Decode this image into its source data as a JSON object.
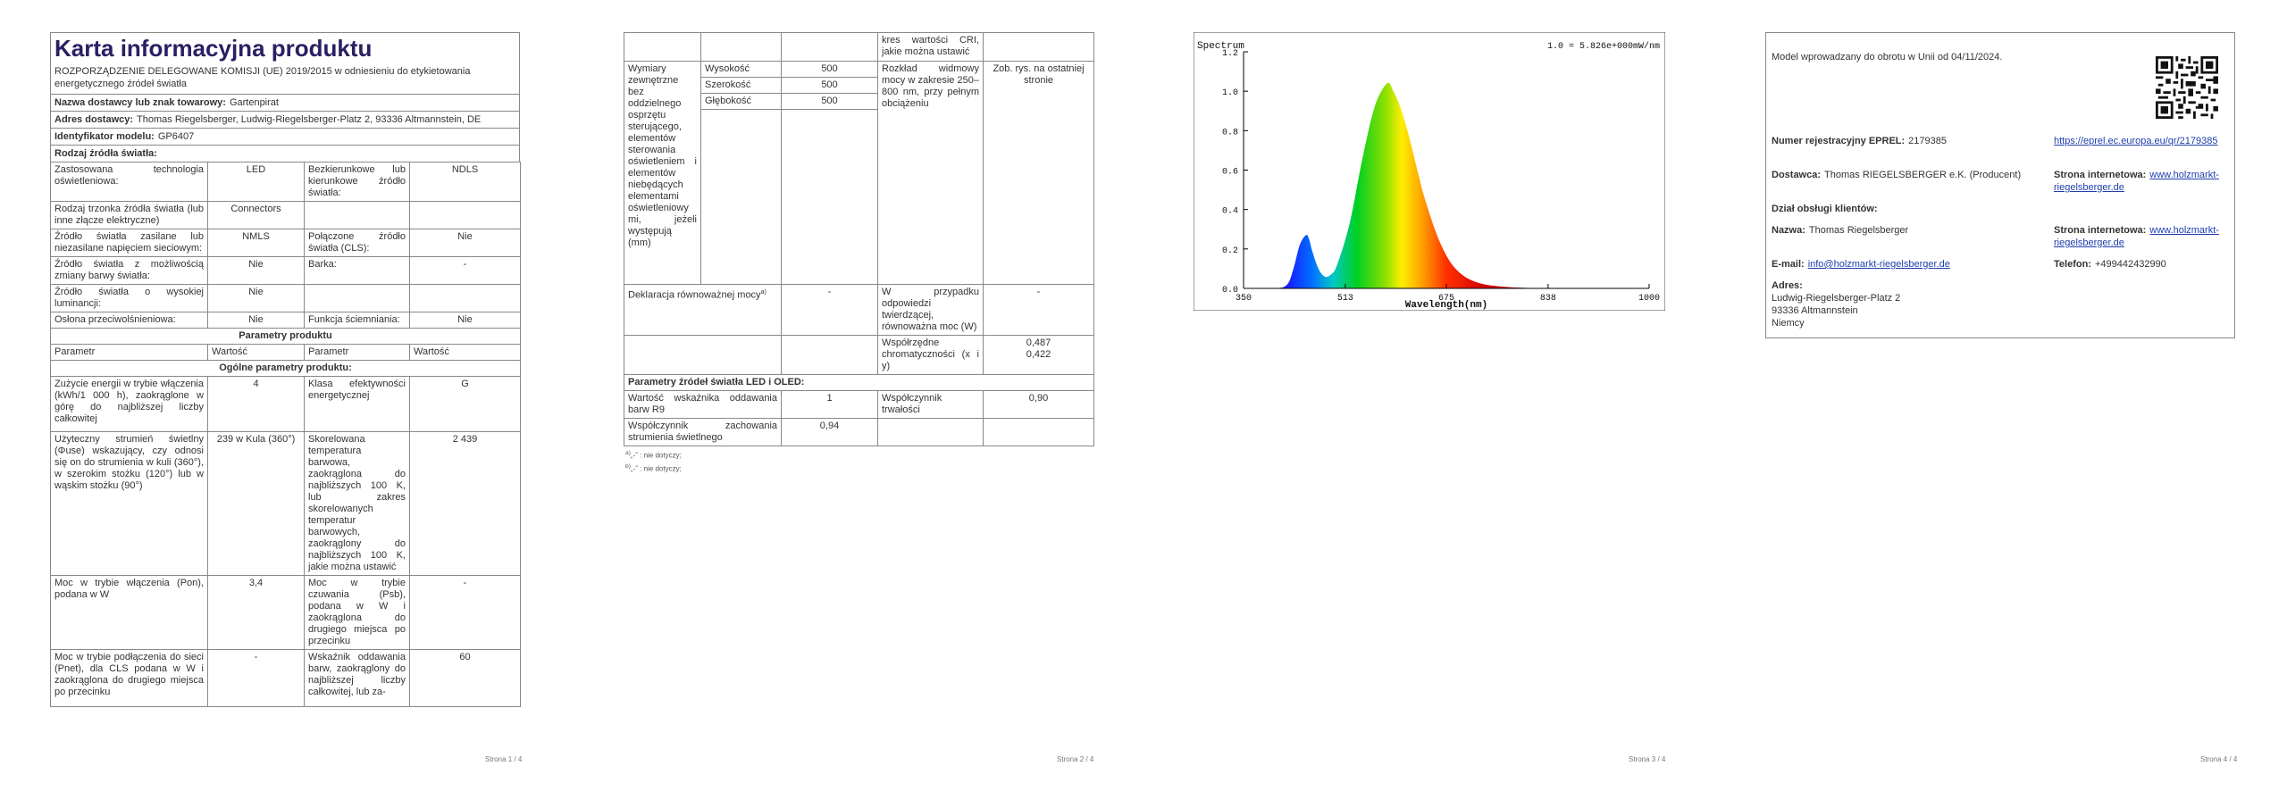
{
  "page1": {
    "title": "Karta informacyjna produktu",
    "subtitle": "ROZPORZĄDZENIE DELEGOWANE KOMISJI (UE) 2019/2015 w odniesieniu do etykietowania energetycznego źródeł światła",
    "supplier_label": "Nazwa dostawcy lub znak towarowy:",
    "supplier_value": "Gartenpirat",
    "address_label": "Adres dostawcy:",
    "address_value": "Thomas Riegelsberger, Ludwig-Riegelsberger-Platz 2, 93336 Altmannstein, DE",
    "model_label": "Identyfikator modelu:",
    "model_value": "GP6407",
    "source_type_header": "Rodzaj źródła światła:",
    "source_rows": [
      [
        "Zastosowana technologia oświetleniowa:",
        "LED",
        "Bezkierunkowe lub kierunkowe źródło światła:",
        "NDLS"
      ],
      [
        "Rodzaj trzonka źródła światła (lub inne złącze elektryczne)",
        "Connectors",
        "",
        ""
      ],
      [
        "Źródło światła zasilane lub niezasilane napięciem sieciowym:",
        "NMLS",
        "Połączone źródło światła (CLS):",
        "Nie"
      ],
      [
        "Źródło światła z możliwością zmiany barwy światła:",
        "Nie",
        "Barka:",
        "-"
      ],
      [
        "Źródło światła o wysokiej luminancji:",
        "Nie",
        "",
        ""
      ],
      [
        "Osłona przeciwolśnieniowa:",
        "Nie",
        "Funkcja ściemniania:",
        "Nie"
      ]
    ],
    "params_header": "Parametry produktu",
    "col_headers": [
      "Parametr",
      "Wartość",
      "Parametr",
      "Wartość"
    ],
    "general_header": "Ogólne parametry produktu:",
    "general_rows": [
      [
        "Zużycie energii w trybie włączenia (kWh/1 000 h), zaokrąglone w górę do najbliższej liczby całkowitej",
        "4",
        "Klasa efektywności energetycznej",
        "G"
      ],
      [
        "Użyteczny strumień świetlny (Φuse) wskazujący, czy odnosi się on do strumienia w kuli (360°), w szerokim stożku (120°) lub w wąskim stożku (90°)",
        "239 w Kula (360°)",
        "Skorelowana temperatura barwowa, zaokrąglona do najbliższych 100 K, lub zakres skorelowanych temperatur barwowych, zaokrąglony do najbliższych 100 K, jakie można ustawić",
        "2 439"
      ],
      [
        "Moc w trybie włączenia (Pon), podana w W",
        "3,4",
        "Moc w trybie czuwania (Psb), podana w W i zaokrąglona do drugiego miejsca po przecinku",
        "-"
      ],
      [
        "Moc w trybie podłączenia do sieci (Pnet), dla CLS podana w W i zaokrąglona do drugiego miejsca po przecinku",
        "-",
        "Wskaźnik oddawania barw, zaokrąglony do najbliższej liczby całkowitej, lub za-",
        "60"
      ]
    ],
    "page_number": "Strona 1 / 4"
  },
  "page2": {
    "top_row": [
      "",
      "",
      "",
      "kres wartości CRI, jakie można ustawić",
      ""
    ],
    "dims_label": "Wymiary zewnętrzne bez oddzielnego osprzętu sterującego, elementów sterowania oświetleniem i elementów niebędących elementami oświetleniowymi, jeżeli występują (mm)",
    "dims": [
      [
        "Wysokość",
        "500"
      ],
      [
        "Szerokość",
        "500"
      ],
      [
        "Głębokość",
        "500"
      ]
    ],
    "spectrum_label": "Rozkład widmowy mocy w zakresie 250–800 nm, przy pełnym obciążeniu",
    "spectrum_value": "Zob. rys. na ostatniej stronie",
    "equiv_label": "Deklaracja równoważnej mocy",
    "equiv_sup": "a)",
    "equiv_value": "-",
    "directional_label": "W przypadku odpowiedzi twierdzącej, równoważna moc (W)",
    "directional_value": "-",
    "chroma_label": "Współrzędne chromatyczności (x i y)",
    "chroma_value_x": "0,487",
    "chroma_value_y": "0,422",
    "led_header": "Parametry źródeł światła LED i OLED:",
    "led_rows": [
      [
        "Wartość wskaźnika oddawania barw R9",
        "1",
        "Współczynnik trwałości",
        "0,90"
      ],
      [
        "Współczynnik zachowania strumienia świetlnego",
        "0,94",
        "",
        ""
      ]
    ],
    "notes": [
      {
        "sup": "a)",
        "text": "„-” : nie dotyczy;"
      },
      {
        "sup": "b)",
        "text": "„-” : nie dotyczy;"
      }
    ],
    "page_number": "Strona 2 / 4"
  },
  "page3": {
    "page_number": "Strona 3 / 4"
  },
  "chart_data": {
    "type": "area",
    "title": "Spectrum",
    "annotation": "1.0 = 5.826e+000mW/nm",
    "xlabel": "Wavelength(nm)",
    "ylabel": "",
    "xlim": [
      350,
      1000
    ],
    "ylim": [
      0,
      1.2
    ],
    "x_ticks": [
      350,
      513,
      675,
      838,
      1000
    ],
    "y_ticks": [
      "0.0",
      "0.2",
      "0.4",
      "0.6",
      "0.8",
      "1.0",
      "1.2"
    ],
    "x": [
      350,
      400,
      420,
      430,
      440,
      450,
      455,
      460,
      470,
      480,
      490,
      500,
      520,
      540,
      560,
      580,
      590,
      600,
      610,
      620,
      630,
      640,
      660,
      680,
      700,
      720,
      740,
      760,
      780,
      800,
      850,
      900,
      950,
      1000
    ],
    "y": [
      0.0,
      0.0,
      0.02,
      0.1,
      0.22,
      0.27,
      0.25,
      0.19,
      0.1,
      0.06,
      0.07,
      0.12,
      0.33,
      0.65,
      0.92,
      1.04,
      1.0,
      0.93,
      0.83,
      0.71,
      0.58,
      0.46,
      0.27,
      0.14,
      0.07,
      0.035,
      0.018,
      0.01,
      0.005,
      0.003,
      0.0,
      0.0,
      0.0,
      0.0
    ]
  },
  "page4": {
    "intro": "Model wprowadzany do obrotu w Unii od 04/11/2024.",
    "eprel_label": "Numer rejestracyjny EPREL:",
    "eprel_value": "2179385",
    "eprel_link": "https://eprel.ec.europa.eu/qr/2179385",
    "supplier_label": "Dostawca:",
    "supplier_value": "Thomas RIEGELSBERGER e.K. (Producent)",
    "web_label": "Strona internetowa:",
    "web_value": "www.holzmarkt-riegelsberger.de",
    "service_header": "Dział obsługi klientów:",
    "name_label": "Nazwa:",
    "name_value": "Thomas Riegelsberger",
    "web2_label": "Strona internetowa:",
    "web2_value": "www.holzmarkt-riegelsberger.de",
    "email_label": "E-mail:",
    "email_value": "info@holzmarkt-riegelsberger.de",
    "phone_label": "Telefon:",
    "phone_value": "+499442432990",
    "address_label": "Adres:",
    "address_lines": [
      "Ludwig-Riegelsberger-Platz 2",
      "93336 Altmannstein",
      "Niemcy"
    ],
    "page_number": "Strona 4 / 4"
  }
}
